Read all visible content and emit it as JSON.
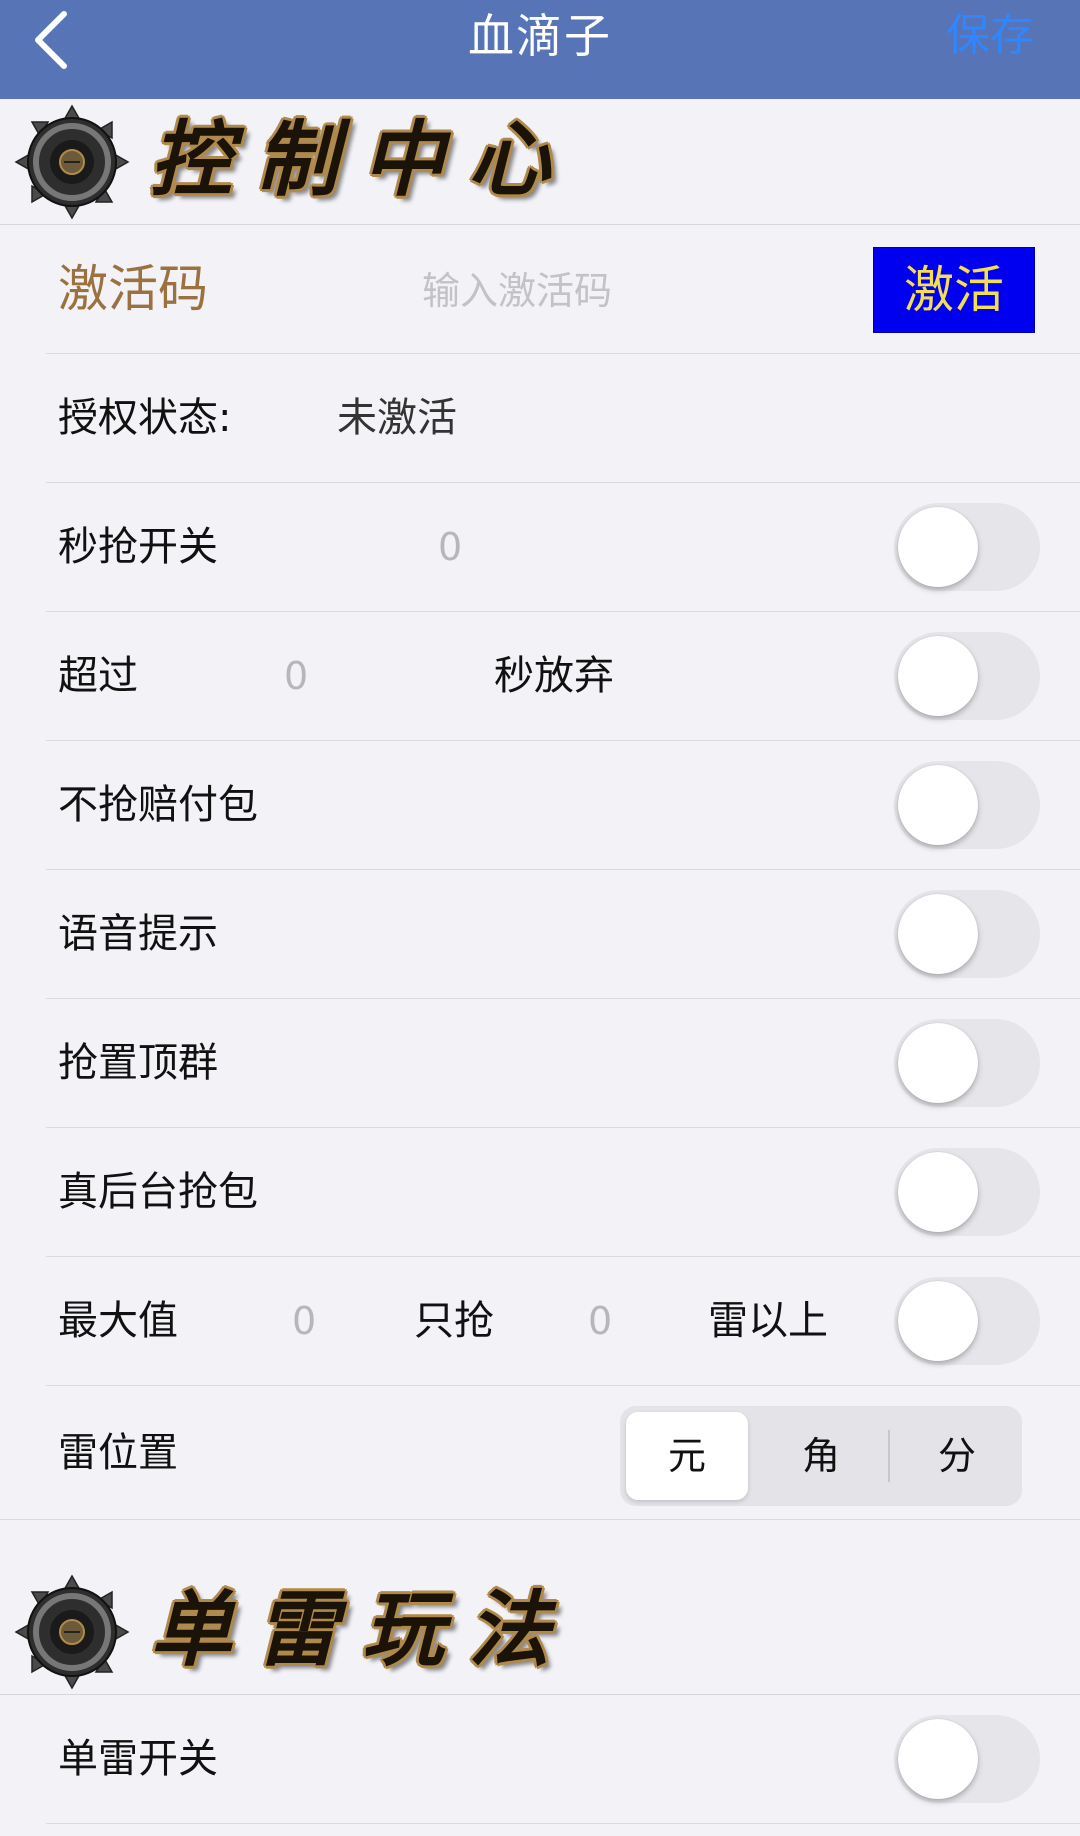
{
  "nav": {
    "title": "血滴子",
    "save_label": "保存"
  },
  "sections": {
    "control_center": "控制中心",
    "single_mine": "单雷玩法"
  },
  "activation": {
    "label": "激活码",
    "placeholder": "输入激活码",
    "value": "",
    "button_label": "激活"
  },
  "auth": {
    "label": "授权状态:",
    "status": "未激活"
  },
  "rows": {
    "seckill": {
      "label": "秒抢开关",
      "value": "0",
      "on": false
    },
    "timeout": {
      "label": "超过",
      "value": "0",
      "suffix": "秒放弃",
      "on": false
    },
    "no_compensation": {
      "label": "不抢赔付包",
      "on": false
    },
    "voice": {
      "label": "语音提示",
      "on": false
    },
    "pinned": {
      "label": "抢置顶群",
      "on": false
    },
    "background": {
      "label": "真后台抢包",
      "on": false
    },
    "max_value": {
      "label": "最大值",
      "value": "0",
      "only_label": "只抢",
      "only_value": "0",
      "suffix": "雷以上",
      "on": false
    },
    "mine_position": {
      "label": "雷位置",
      "options": [
        "元",
        "角",
        "分"
      ],
      "selected": "元"
    },
    "single_mine_switch": {
      "label": "单雷开关",
      "on": false
    }
  },
  "colors": {
    "nav_bg": "#5674b6",
    "save_blue": "#2f86ff",
    "activate_bg": "#0000f0",
    "activate_text": "#f2de50",
    "activation_label": "#9c7140",
    "banner_gold": "#b08a4a"
  },
  "icons": {
    "back": "chevron-left-icon",
    "emblem": "spiked-disc-emblem-icon"
  }
}
